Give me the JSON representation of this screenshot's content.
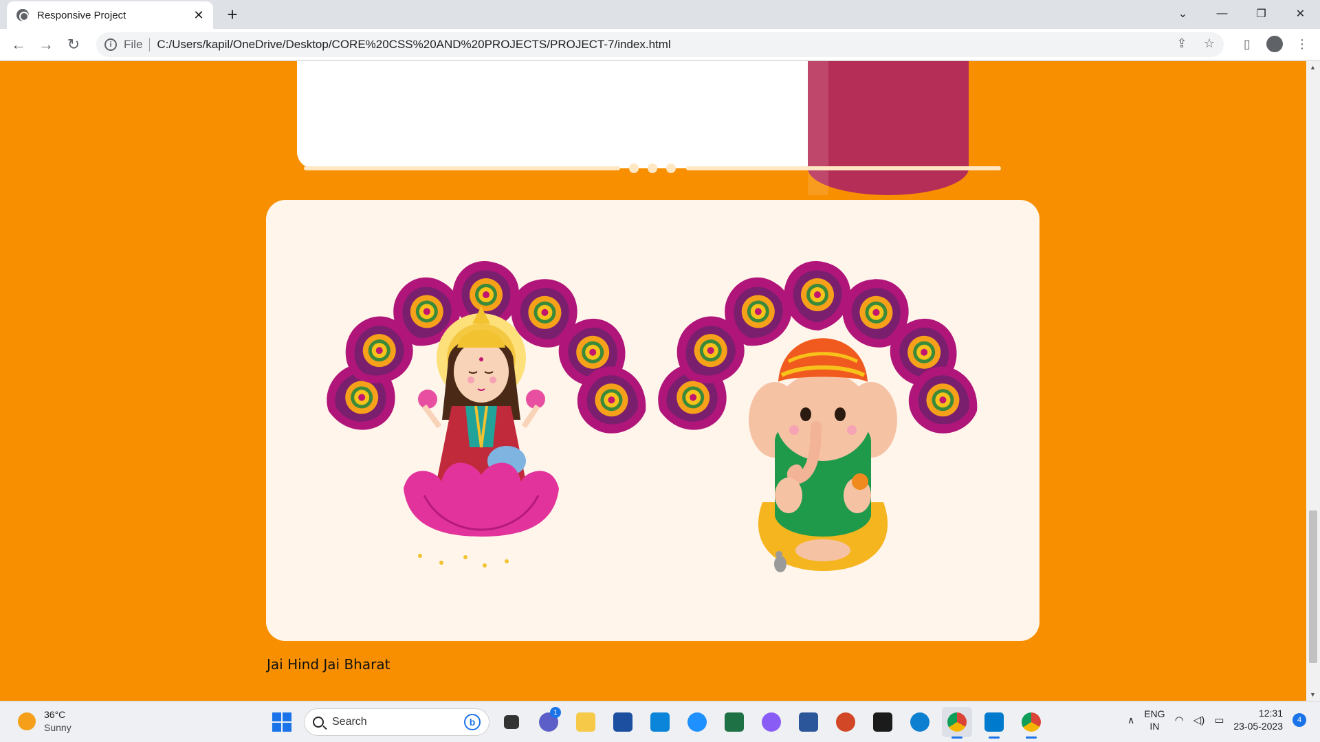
{
  "browser": {
    "tab_title": "Responsive Project",
    "tab_close": "✕",
    "new_tab": "+",
    "scheme": "File",
    "url": "C:/Users/kapil/OneDrive/Desktop/CORE%20CSS%20AND%20PROJECTS/PROJECT-7/index.html",
    "window_controls": [
      "⌄",
      "—",
      "❐",
      "✕"
    ]
  },
  "page": {
    "footer_text": "Jai Hind Jai Bharat",
    "colors": {
      "background": "#f78f00",
      "card": "#fff5ea",
      "divider": "#ffe7c4",
      "paisley_outer": "#b0157a",
      "paisley_inner": "#7a1f6e",
      "flower": "#f7a11a"
    }
  },
  "taskbar": {
    "weather": {
      "temp": "36°C",
      "condition": "Sunny"
    },
    "search_placeholder": "Search",
    "bing_label": "b",
    "teams_badge": "1",
    "lang_top": "ENG",
    "lang_bottom": "IN",
    "time": "12:31",
    "date": "23-05-2023",
    "notification_count": "4",
    "apps": [
      "start",
      "search",
      "task-view",
      "teams",
      "file-explorer",
      "store",
      "myhp",
      "help",
      "excel",
      "copilot",
      "word",
      "powerpoint",
      "terminal",
      "edge",
      "chrome",
      "vscode",
      "chrome-2"
    ]
  }
}
